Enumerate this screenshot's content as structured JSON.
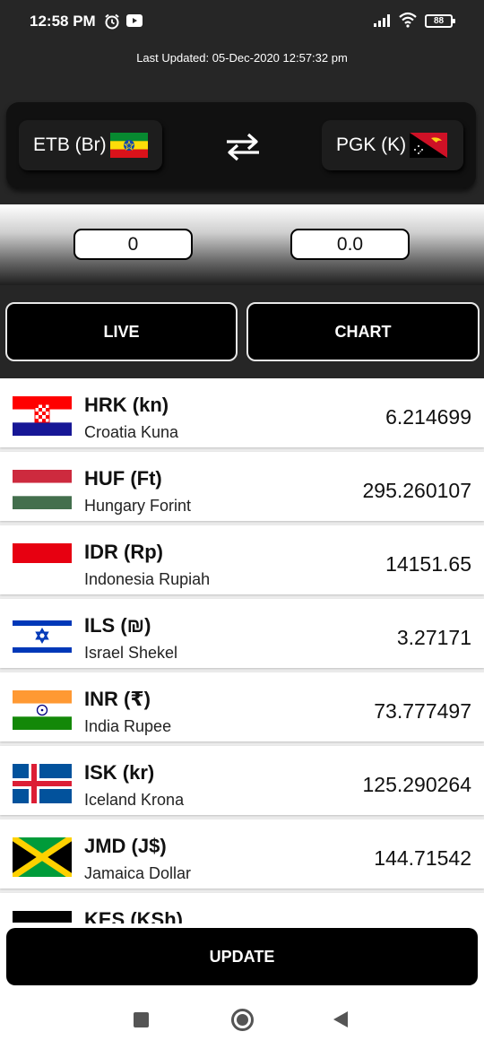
{
  "status_bar": {
    "time": "12:58 PM",
    "battery": "88",
    "icons": [
      "alarm-icon",
      "youtube-icon",
      "signal-icon",
      "wifi-icon",
      "battery-icon"
    ]
  },
  "header": {
    "last_updated": "Last Updated: 05-Dec-2020 12:57:32 pm",
    "from_currency": "ETB (Br)",
    "to_currency": "PGK (K)"
  },
  "converter": {
    "from_amount": "0",
    "to_amount": "0.0"
  },
  "tabs": {
    "live": "LIVE",
    "chart": "CHART"
  },
  "currencies": [
    {
      "code": "HRK (kn)",
      "name": "Croatia Kuna",
      "rate": "6.214699",
      "flag": "croatia"
    },
    {
      "code": "HUF (Ft)",
      "name": "Hungary Forint",
      "rate": "295.260107",
      "flag": "hungary"
    },
    {
      "code": "IDR (Rp)",
      "name": "Indonesia Rupiah",
      "rate": "14151.65",
      "flag": "indonesia"
    },
    {
      "code": "ILS (₪)",
      "name": "Israel Shekel",
      "rate": "3.27171",
      "flag": "israel"
    },
    {
      "code": "INR (₹)",
      "name": "India Rupee",
      "rate": "73.777497",
      "flag": "india"
    },
    {
      "code": "ISK (kr)",
      "name": "Iceland Krona",
      "rate": "125.290264",
      "flag": "iceland"
    },
    {
      "code": "JMD (J$)",
      "name": "Jamaica Dollar",
      "rate": "144.71542",
      "flag": "jamaica"
    },
    {
      "code": "KES (KSh)",
      "name": "",
      "rate": "",
      "flag": "kenya"
    }
  ],
  "update_label": "UPDATE",
  "colors": {
    "header_bg": "#262626",
    "button_bg": "#000000",
    "text_light": "#ffffff"
  }
}
